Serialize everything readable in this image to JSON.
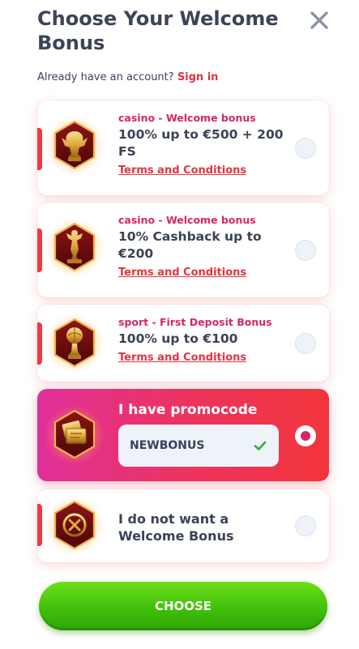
{
  "header": {
    "title": "Choose Your Welcome Bonus",
    "already_text": "Already have an account?",
    "signin_label": "Sign in"
  },
  "bonuses": [
    {
      "tag": "casino - Welcome bonus",
      "headline": "100% up to €500 + 200 FS",
      "terms": "Terms and Conditions",
      "icon": "golden-dragon-trophy-icon",
      "selected": false
    },
    {
      "tag": "casino - Welcome bonus",
      "headline": "10% Cashback up to €200",
      "terms": "Terms and Conditions",
      "icon": "golden-figure-trophy-icon",
      "selected": false
    },
    {
      "tag": "sport - First Deposit Bonus",
      "headline": "100% up to €100",
      "terms": "Terms and Conditions",
      "icon": "golden-ball-trophy-icon",
      "selected": false
    }
  ],
  "promo": {
    "label": "I have promocode",
    "code": "NEWBONUS",
    "icon": "coupon-tickets-icon",
    "selected": true
  },
  "no_bonus": {
    "label": "I do not want a Welcome Bonus",
    "icon": "no-bonus-x-icon",
    "selected": false
  },
  "action": {
    "choose_label": "CHOOSE"
  },
  "colors": {
    "accent_red": "#e3343f",
    "tag_pink": "#d6266a",
    "promo_gradient_start": "#e0309a",
    "promo_gradient_end": "#f2353b",
    "button_green": "#3fbd0a",
    "valid_check": "#3aa845"
  }
}
